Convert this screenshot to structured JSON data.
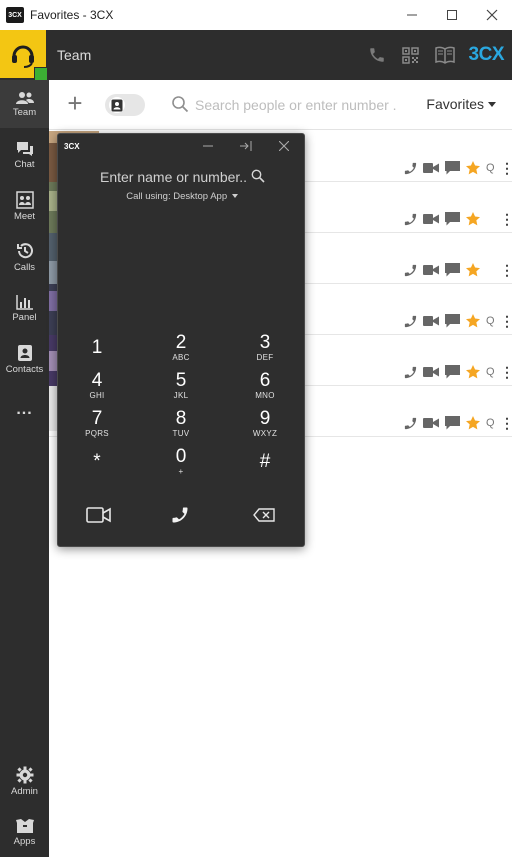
{
  "window": {
    "title": "Favorites - 3CX",
    "logo_text": "3CX"
  },
  "header": {
    "page_title": "Team",
    "brand": "3CX",
    "brand_accent": "#2aa8e0",
    "status_color": "#3cb034",
    "avatar_color": "#f3c613"
  },
  "sidebar": {
    "items": [
      {
        "label": "Team",
        "icon": "team-icon"
      },
      {
        "label": "Chat",
        "icon": "chat-icon"
      },
      {
        "label": "Meet",
        "icon": "meet-icon"
      },
      {
        "label": "Calls",
        "icon": "history-icon"
      },
      {
        "label": "Panel",
        "icon": "panel-icon"
      },
      {
        "label": "Contacts",
        "icon": "contacts-icon"
      },
      {
        "label": "...",
        "icon": "more-icon"
      },
      {
        "label": "Admin",
        "icon": "gear-icon"
      },
      {
        "label": "Apps",
        "icon": "apps-icon"
      }
    ]
  },
  "toolbar": {
    "add_label": "+",
    "search_placeholder": "Search people or enter number .",
    "filter_label": "Favorites"
  },
  "rows": [
    {
      "has_queue": true
    },
    {
      "has_queue": false
    },
    {
      "has_queue": false
    },
    {
      "has_queue": true
    },
    {
      "has_queue": true
    },
    {
      "has_queue": true
    }
  ],
  "row_labels": {
    "queue": "Q",
    "more": "⋮"
  },
  "dialer": {
    "logo": "3CX",
    "input_placeholder": "Enter name or number..",
    "call_using": "Call using: Desktop App",
    "keys": [
      {
        "num": "1",
        "sub": ""
      },
      {
        "num": "2",
        "sub": "ABC"
      },
      {
        "num": "3",
        "sub": "DEF"
      },
      {
        "num": "4",
        "sub": "GHI"
      },
      {
        "num": "5",
        "sub": "JKL"
      },
      {
        "num": "6",
        "sub": "MNO"
      },
      {
        "num": "7",
        "sub": "PQRS"
      },
      {
        "num": "8",
        "sub": "TUV"
      },
      {
        "num": "9",
        "sub": "WXYZ"
      },
      {
        "num": "*",
        "sub": ""
      },
      {
        "num": "0",
        "sub": "+"
      },
      {
        "num": "#",
        "sub": ""
      }
    ]
  }
}
